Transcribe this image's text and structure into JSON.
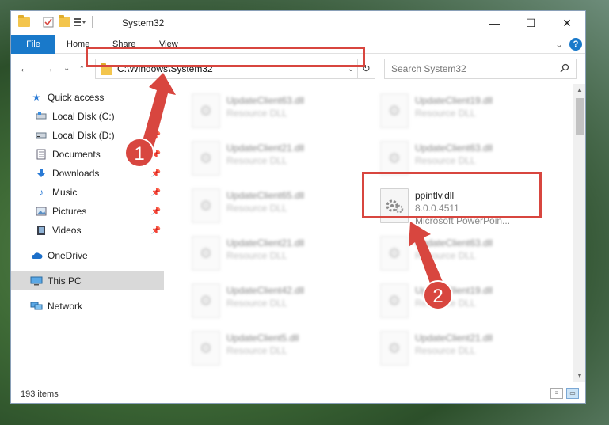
{
  "window": {
    "title": "System32",
    "controls": {
      "minimize": "—",
      "maximize": "☐",
      "close": "✕"
    }
  },
  "ribbon": {
    "tabs": [
      "File",
      "Home",
      "Share",
      "View"
    ],
    "help": "?",
    "collapse": "⌄"
  },
  "navbar": {
    "back": "←",
    "forward": "→",
    "recent": "⌄",
    "up": "↑",
    "address": "C:\\Windows\\System32",
    "dropdown": "⌄",
    "refresh": "↻",
    "search_placeholder": "Search System32"
  },
  "sidebar": {
    "quick_access": "Quick access",
    "items": [
      {
        "label": "Local Disk (C:)",
        "icon": "drive-icon",
        "pinned": true
      },
      {
        "label": "Local Disk (D:)",
        "icon": "drive-icon",
        "pinned": true
      },
      {
        "label": "Documents",
        "icon": "documents-icon",
        "pinned": true
      },
      {
        "label": "Downloads",
        "icon": "downloads-icon",
        "pinned": true
      },
      {
        "label": "Music",
        "icon": "music-icon",
        "pinned": true
      },
      {
        "label": "Pictures",
        "icon": "pictures-icon",
        "pinned": true
      },
      {
        "label": "Videos",
        "icon": "videos-icon",
        "pinned": true
      }
    ],
    "onedrive": "OneDrive",
    "thispc": "This PC",
    "network": "Network"
  },
  "files": {
    "left": [
      {
        "name": "UpdateClient63.dll",
        "desc": "Resource DLL"
      },
      {
        "name": "UpdateClient21.dll",
        "desc": "Resource DLL"
      },
      {
        "name": "UpdateClient65.dll",
        "desc": "Resource DLL"
      },
      {
        "name": "UpdateClient21.dll",
        "desc": "Resource DLL"
      },
      {
        "name": "UpdateClient42.dll",
        "desc": "Resource DLL"
      },
      {
        "name": "UpdateClient5.dll",
        "desc": "Resource DLL"
      }
    ],
    "right": [
      {
        "name": "UpdateClient19.dll",
        "desc": "Resource DLL"
      },
      {
        "name": "UpdateClient63.dll",
        "desc": "Resource DLL"
      },
      {
        "name": "ppintlv.dll",
        "desc": "8.0.0.4511",
        "desc2": "Microsoft PowerPoin..."
      },
      {
        "name": "UpdateClient63.dll",
        "desc": "Resource DLL"
      },
      {
        "name": "UpdateClient19.dll",
        "desc": "Resource DLL"
      },
      {
        "name": "UpdateClient21.dll",
        "desc": "Resource DLL"
      }
    ]
  },
  "status": {
    "count": "193 items"
  },
  "annotations": {
    "badge1": "1",
    "badge2": "2",
    "color": "#d8463f"
  }
}
